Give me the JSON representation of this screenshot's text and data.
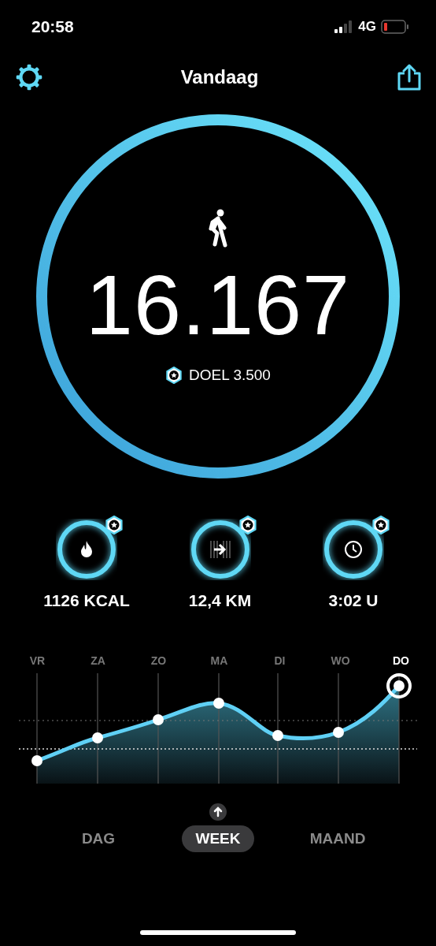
{
  "status_bar": {
    "time": "20:58",
    "network": "4G"
  },
  "header": {
    "title": "Vandaag"
  },
  "steps": {
    "count": "16.167",
    "goal": "DOEL 3.500"
  },
  "stats": [
    {
      "kind": "calories",
      "value": "1126 KCAL"
    },
    {
      "kind": "distance",
      "value": "12,4 KM"
    },
    {
      "kind": "time",
      "value": "3:02 U"
    }
  ],
  "chart": {
    "days": [
      {
        "label": "VR",
        "selected": false
      },
      {
        "label": "ZA",
        "selected": false
      },
      {
        "label": "ZO",
        "selected": false
      },
      {
        "label": "MA",
        "selected": false
      },
      {
        "label": "DI",
        "selected": false
      },
      {
        "label": "WO",
        "selected": false
      },
      {
        "label": "DO",
        "selected": true
      }
    ]
  },
  "tabs": [
    {
      "label": "DAG",
      "selected": false
    },
    {
      "label": "WEEK",
      "selected": true
    },
    {
      "label": "MAAND",
      "selected": false
    }
  ]
}
